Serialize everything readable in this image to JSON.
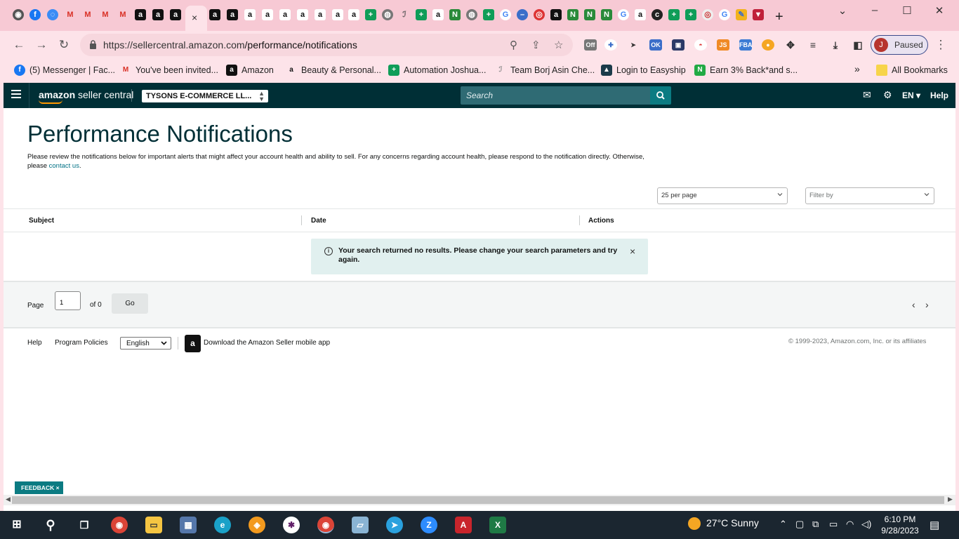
{
  "browser": {
    "url_host": "https://sellercentral.amazon.com",
    "url_path": "/performance/notifications",
    "profile_initial": "J",
    "profile_label": "Paused",
    "new_tab": "+",
    "tab_close": "×",
    "bookmarks": [
      {
        "label": "(5) Messenger | Fac...",
        "icon": "facebook-icon",
        "color": "#1877f2"
      },
      {
        "label": "You've been invited...",
        "icon": "gmail-icon",
        "color": "#d93025"
      },
      {
        "label": "Amazon",
        "icon": "amazon-icon",
        "color": "#111111"
      },
      {
        "label": "Beauty & Personal...",
        "icon": "amazon-smile-icon",
        "color": "#ff9900"
      },
      {
        "label": "Automation Joshua...",
        "icon": "sheets-icon",
        "color": "#0f9d58"
      },
      {
        "label": "Team Borj Asin Che...",
        "icon": "signature-icon",
        "color": "#888888"
      },
      {
        "label": "Login to Easyship",
        "icon": "easyship-icon",
        "color": "#1b3b4a"
      },
      {
        "label": "Earn 3% Back*and s...",
        "icon": "cashback-icon",
        "color": "#22aa44"
      }
    ],
    "bookmarks_overflow": "»",
    "all_bookmarks": "All Bookmarks"
  },
  "header": {
    "logo_bold": "amazon",
    "logo_rest": " seller central",
    "store": "TYSONS E-COMMERCE LL...",
    "search_placeholder": "Search",
    "language": "EN",
    "help": "Help"
  },
  "page": {
    "title": "Performance Notifications",
    "intro": "Please review the notifications below for important alerts that might affect your account health and ability to sell. For any concerns regarding account health, please respond to the notification directly. Otherwise, please ",
    "intro_link": "contact us",
    "intro_end": ".",
    "per_page": "25 per page",
    "filter_placeholder": "Filter by",
    "columns": [
      "Subject",
      "Date",
      "Actions"
    ],
    "alert_message": "Your search returned no results. Please change your search parameters and try again.",
    "alert_close": "×",
    "pager": {
      "page_label": "Page",
      "page_value": "1",
      "of_label": "of 0",
      "go": "Go",
      "prev": "‹",
      "next": "›"
    }
  },
  "footer": {
    "help": "Help",
    "policies": "Program Policies",
    "language": "English",
    "app_link": "Download the Amazon Seller mobile app",
    "copyright": "© 1999-2023, Amazon.com, Inc. or its affiliates"
  },
  "feedback": {
    "label": "FEEDBACK",
    "close": "×"
  },
  "taskbar": {
    "weather": "27°C  Sunny",
    "time": "6:10 PM",
    "date": "9/28/2023"
  },
  "colors": {
    "chrome_pink": "#f7c9d4",
    "seller_header": "#002f36",
    "accent_teal": "#0b7b82",
    "link": "#007185"
  }
}
